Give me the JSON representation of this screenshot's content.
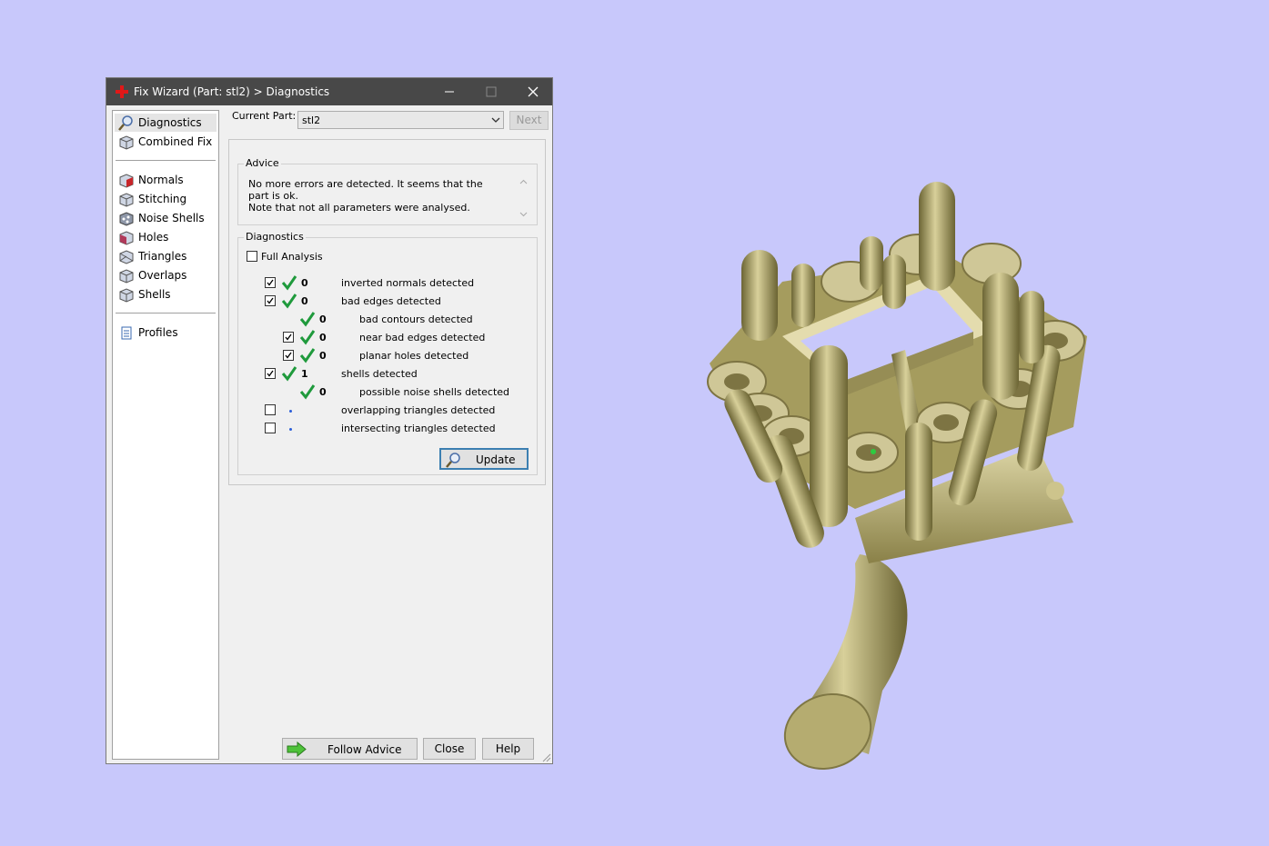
{
  "window": {
    "title": "Fix Wizard (Part: stl2) > Diagnostics"
  },
  "nav": {
    "items": [
      {
        "label": "Diagnostics"
      },
      {
        "label": "Combined Fix"
      },
      {
        "label": "Normals"
      },
      {
        "label": "Stitching"
      },
      {
        "label": "Noise Shells"
      },
      {
        "label": "Holes"
      },
      {
        "label": "Triangles"
      },
      {
        "label": "Overlaps"
      },
      {
        "label": "Shells"
      },
      {
        "label": "Profiles"
      }
    ]
  },
  "current_part": {
    "label": "Current Part:",
    "value": "stl2",
    "next_label": "Next"
  },
  "advice": {
    "title": "Advice",
    "line1": "No more errors are detected. It seems that the part is ok.",
    "line2": "Note that not all parameters were analysed."
  },
  "diagnostics": {
    "title": "Diagnostics",
    "full_analysis_label": "Full Analysis",
    "full_analysis_checked": false,
    "rows": [
      {
        "checked": true,
        "status": "ok",
        "count": "0",
        "label": "inverted normals detected"
      },
      {
        "checked": true,
        "status": "ok",
        "count": "0",
        "label": "bad edges detected"
      },
      {
        "checked": null,
        "status": "ok",
        "count": "0",
        "label": "bad contours detected"
      },
      {
        "checked": true,
        "status": "ok",
        "count": "0",
        "label": "near bad edges detected"
      },
      {
        "checked": true,
        "status": "ok",
        "count": "0",
        "label": "planar holes detected"
      },
      {
        "checked": true,
        "status": "ok",
        "count": "1",
        "label": "shells detected"
      },
      {
        "checked": null,
        "status": "ok",
        "count": "0",
        "label": "possible noise shells detected"
      },
      {
        "checked": false,
        "status": "not-run",
        "count": "",
        "label": "overlapping triangles detected"
      },
      {
        "checked": false,
        "status": "not-run",
        "count": "",
        "label": "intersecting triangles detected"
      }
    ],
    "update_label": "Update"
  },
  "footer": {
    "follow_advice_label": "Follow Advice",
    "close_label": "Close",
    "help_label": "Help"
  },
  "colors": {
    "background": "#c8c8fb",
    "titlebar": "#484848",
    "model": "#b5ac6c",
    "ok_green": "#1f9a3c"
  }
}
